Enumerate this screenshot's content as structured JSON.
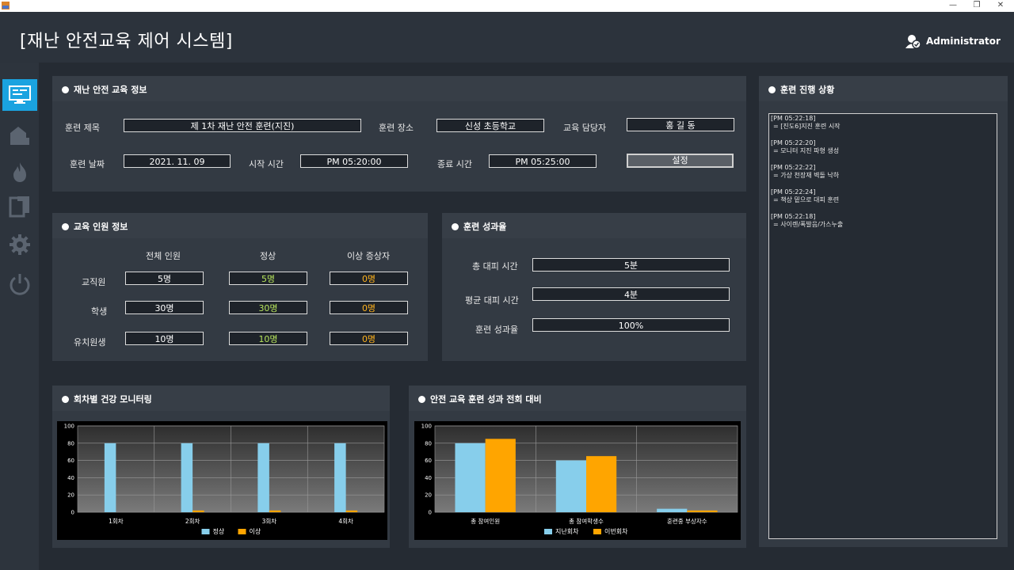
{
  "app": {
    "title": "[재난 안전교육 제어 시스템]",
    "user": "Administrator"
  },
  "window": {
    "min": "—",
    "max": "❐",
    "close": "✕"
  },
  "info": {
    "title": "재난 안전 교육 정보",
    "name_label": "훈련 제목",
    "name_value": "제 1차 재난 안전 훈련(지진)",
    "place_label": "훈련 장소",
    "place_value": "신성 초등학교",
    "manager_label": "교육 담당자",
    "manager_value": "홍 길 동",
    "date_label": "훈련 날짜",
    "date_value": "2021. 11. 09",
    "start_label": "시작 시간",
    "start_value": "PM 05:20:00",
    "end_label": "종료 시간",
    "end_value": "PM 05:25:00",
    "set_button": "설정"
  },
  "people": {
    "title": "교육 인원 정보",
    "headers": [
      "전체 인원",
      "정상",
      "이상 증상자"
    ],
    "rows": [
      {
        "label": "교직원",
        "total": "5명",
        "normal": "5명",
        "abnormal": "0명"
      },
      {
        "label": "학생",
        "total": "30명",
        "normal": "30명",
        "abnormal": "0명"
      },
      {
        "label": "유치원생",
        "total": "10명",
        "normal": "10명",
        "abnormal": "0명"
      }
    ]
  },
  "result": {
    "title": "훈련 성과율",
    "total_time_label": "총 대피 시간",
    "total_time": "5분",
    "avg_time_label": "평균 대피 시간",
    "avg_time": "4분",
    "rate_label": "훈련 성과율",
    "rate": "100%"
  },
  "progress": {
    "title": "훈련 진행 상황",
    "logs": [
      {
        "time": "[PM 05:22:18]",
        "msg": "= [진도6]지진 훈련 시작"
      },
      {
        "time": "[PM 05:22:20]",
        "msg": "= 모니터 지진 파형 생성"
      },
      {
        "time": "[PM 05:22:22]",
        "msg": "= 가상 천장재 벽돌 낙하"
      },
      {
        "time": "[PM 05:22:24]",
        "msg": "= 책상 밑으로 대피 훈련"
      },
      {
        "time": "[PM 05:22:18]",
        "msg": "= 사이렌/폭발음/가스누출"
      }
    ]
  },
  "health_chart": {
    "title": "회차별 건강 모니터링"
  },
  "compare_chart": {
    "title": "안전 교육 훈련 성과 전회 대비"
  },
  "colors": {
    "series_a": "#87ceeb",
    "series_b": "#ffa500",
    "accent": "#1aa3e0"
  },
  "icons": [
    "monitor-icon",
    "building-icon",
    "fire-icon",
    "document-icon",
    "gear-icon",
    "power-icon",
    "user-admin-icon"
  ],
  "chart_data": [
    {
      "type": "bar",
      "categories": [
        "1회차",
        "2회차",
        "3회차",
        "4회차"
      ],
      "series": [
        {
          "name": "정상",
          "values": [
            80,
            80,
            80,
            80
          ]
        },
        {
          "name": "이상",
          "values": [
            0,
            2,
            2,
            2
          ]
        }
      ],
      "ylim": [
        0,
        100
      ],
      "yticks": [
        0,
        20,
        40,
        60,
        80,
        100
      ],
      "grid": true,
      "legend": "bottom"
    },
    {
      "type": "bar",
      "categories": [
        "총 참여인원",
        "총 참여학생수",
        "훈련중 부상자수"
      ],
      "series": [
        {
          "name": "지난회차",
          "values": [
            80,
            60,
            4
          ]
        },
        {
          "name": "이번회차",
          "values": [
            85,
            65,
            2
          ]
        }
      ],
      "ylim": [
        0,
        100
      ],
      "yticks": [
        0,
        20,
        40,
        60,
        80,
        100
      ],
      "grid": true,
      "legend": "bottom"
    }
  ]
}
